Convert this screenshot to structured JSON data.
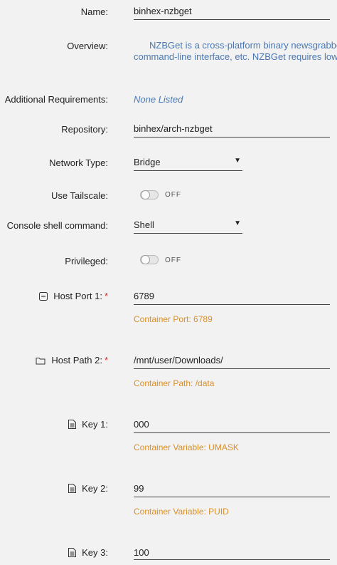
{
  "name": {
    "label": "Name:",
    "value": "binhex-nzbget"
  },
  "overview": {
    "label": "Overview:",
    "line1": "NZBGet is a cross-platform binary newsgrabbe",
    "line2": "command-line interface, etc. NZBGet requires low sys"
  },
  "requirements": {
    "label": "Additional Requirements:",
    "value": "None Listed"
  },
  "repository": {
    "label": "Repository:",
    "value": "binhex/arch-nzbget"
  },
  "network": {
    "label": "Network Type:",
    "value": "Bridge",
    "arrow": "▼"
  },
  "tailscale": {
    "label": "Use Tailscale:",
    "state": "OFF"
  },
  "console": {
    "label": "Console shell command:",
    "value": "Shell",
    "arrow": "▼"
  },
  "privileged": {
    "label": "Privileged:",
    "state": "OFF"
  },
  "host_port": {
    "label": "Host Port 1:",
    "required": "*",
    "value": "6789",
    "note": "Container Port: 6789",
    "icon": "collapse-square-icon"
  },
  "host_path": {
    "label": "Host Path 2:",
    "required": "*",
    "value": "/mnt/user/Downloads/",
    "note": "Container Path: /data",
    "icon": "folder-icon"
  },
  "key1": {
    "label": "Key 1:",
    "value": "000",
    "note": "Container Variable: UMASK",
    "icon": "document-icon"
  },
  "key2": {
    "label": "Key 2:",
    "value": "99",
    "note": "Container Variable: PUID",
    "icon": "document-icon"
  },
  "key3": {
    "label": "Key 3:",
    "value": "100",
    "icon": "document-icon"
  }
}
